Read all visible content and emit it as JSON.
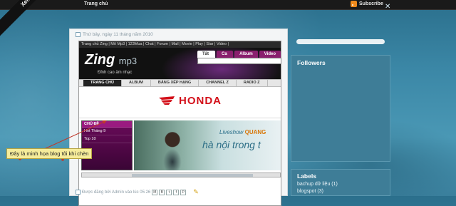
{
  "topbar": {
    "site_name": "Xem",
    "home_label": "Trang chủ",
    "subscribe_label": "Subscribe"
  },
  "post": {
    "date": "Thứ bảy, ngày 11 tháng năm 2010",
    "footer": "Được đăng bởi Admin vào lúc 05:26",
    "share_buttons": [
      "M",
      "B",
      "t",
      "f",
      "P"
    ]
  },
  "zing": {
    "nav_links": "Trang chủ Zing | Mô Mp3 | 123Mua | Chat | Forum | Mail | Movie | Play | Star | Video |",
    "logo": "Zing",
    "logo_suffix": "mp3",
    "slogan": "Đỉnh cao âm nhạc",
    "search_tabs": [
      "Tất cả",
      "Ca sĩ",
      "Album",
      "Video"
    ],
    "menu": [
      "TRANG CHỦ",
      "ALBUM",
      "BẢNG XẾP HẠNG",
      "CHANNEL Z",
      "RADIO Z"
    ],
    "ad_text": "HONDA",
    "side_menu_header": "CHỦ ĐỀ",
    "side_menu_items": [
      "Hot Tháng 9",
      "Top 10"
    ],
    "banner_line1": "Liveshow",
    "banner_line1_name": "QUANG",
    "banner_line2": "hà nội trong t"
  },
  "callout": "Đây là minh họa blog tôi khi chèn",
  "sidebar": {
    "followers_title": "Followers",
    "labels_title": "Labels",
    "labels": [
      "bachup dữ liệu (1)",
      "blogspot (3)"
    ]
  },
  "colors": {
    "honda_red": "#d3101a",
    "zing_purple": "#8a1f6e",
    "callout_yellow": "#f6ec9a"
  }
}
